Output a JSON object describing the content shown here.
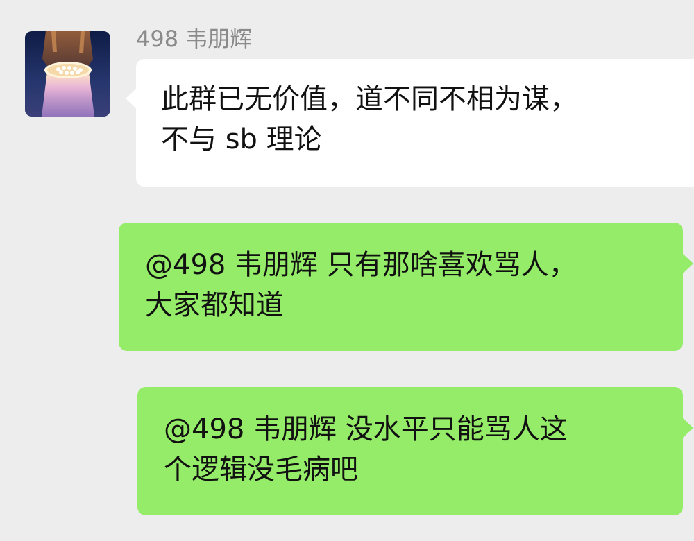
{
  "chat": {
    "messages": [
      {
        "direction": "incoming",
        "sender_name": "498 韦朋辉",
        "lines": [
          "此群已无价值，道不同不相为谋，",
          "不与 sb 理论"
        ]
      },
      {
        "direction": "outgoing",
        "lines": [
          "@498 韦朋辉 只有那啥喜欢骂人，",
          "大家都知道"
        ]
      },
      {
        "direction": "outgoing",
        "lines": [
          "@498 韦朋辉 没水平只能骂人这",
          "个逻辑没毛病吧"
        ]
      }
    ]
  },
  "colors": {
    "background": "#ededed",
    "incoming_bubble": "#ffffff",
    "outgoing_bubble": "#95ec69",
    "sender_name": "#8a8a8a",
    "message_text": "#111111"
  },
  "icons": {
    "avatar": "rocket-launch-photo-avatar"
  }
}
